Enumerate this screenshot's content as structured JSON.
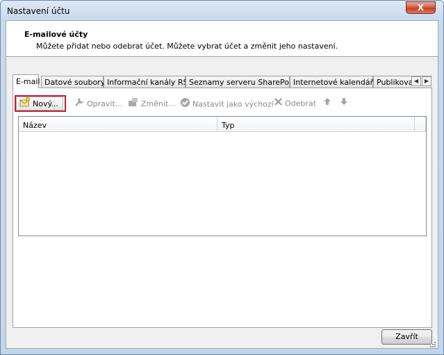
{
  "window": {
    "title": "Nastavení účtu",
    "close_glyph": "X"
  },
  "header": {
    "title": "E-mailové účty",
    "subtitle": "Můžete přidat nebo odebrat účet. Můžete vybrat účet a změnit jeho nastavení."
  },
  "tabs": [
    {
      "label": "E-mail",
      "active": true
    },
    {
      "label": "Datové soubory"
    },
    {
      "label": "Informační kanály RSS"
    },
    {
      "label": "Seznamy serveru SharePoint"
    },
    {
      "label": "Internetové kalendáře"
    },
    {
      "label": "Publikovan"
    }
  ],
  "tab_scroll": {
    "left_icon": "chevron-left-icon",
    "right_icon": "chevron-right-icon"
  },
  "toolbar": {
    "new_label": "Nový...",
    "repair_label": "Opravit...",
    "change_label": "Změnit...",
    "default_label": "Nastavit jako výchozí",
    "remove_label": "Odebrat",
    "highlight_color": "#c0202e"
  },
  "list": {
    "columns": [
      "Název",
      "Typ"
    ],
    "rows": []
  },
  "footer": {
    "close_label": "Zavřít"
  }
}
